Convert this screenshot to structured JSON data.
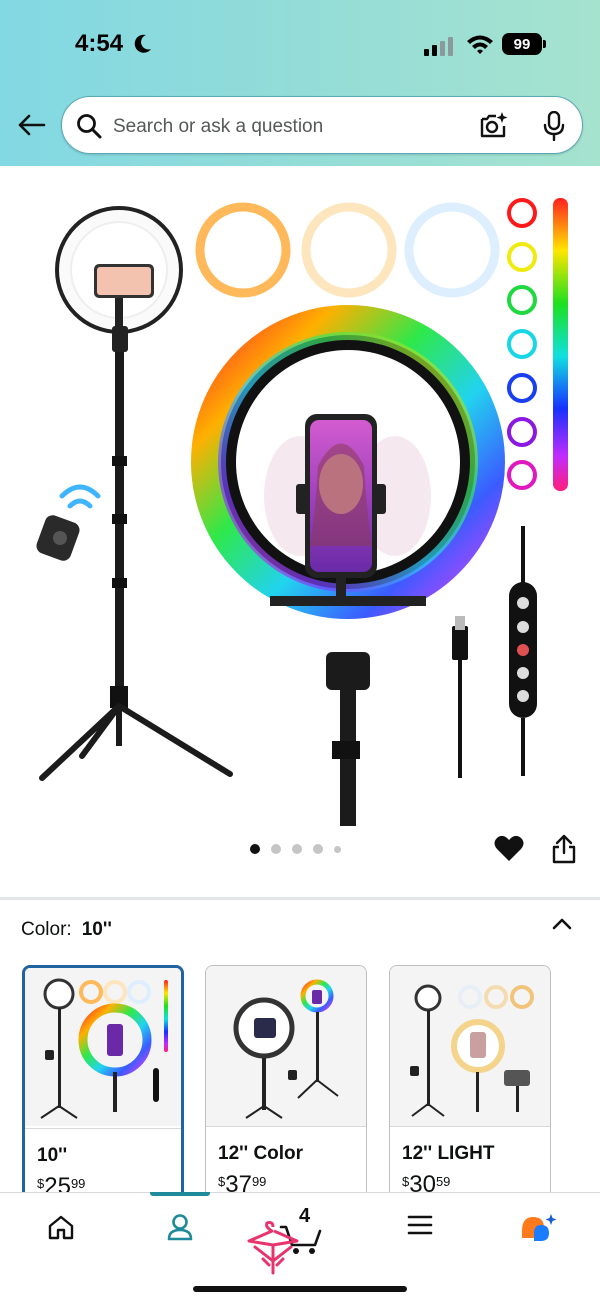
{
  "status_bar": {
    "time": "4:54",
    "battery": "99"
  },
  "search": {
    "placeholder": "Search or ask a question"
  },
  "gallery": {
    "image_count": 5,
    "active_index": 0
  },
  "color_selector": {
    "label": "Color:",
    "selected": "10''"
  },
  "variants": [
    {
      "name": "10''",
      "currency": "$",
      "whole": "25",
      "fraction": "99",
      "selected": true
    },
    {
      "name": "12'' Color",
      "currency": "$",
      "whole": "37",
      "fraction": "99",
      "selected": false
    },
    {
      "name": "12'' LIGHT",
      "currency": "$",
      "whole": "30",
      "fraction": "59",
      "selected": false
    }
  ],
  "bottom_nav": {
    "active": "account",
    "items": [
      "home",
      "account",
      "cart",
      "menu",
      "rufus"
    ],
    "cart_count": "4"
  },
  "colors": {
    "header_start": "#82d8e3",
    "header_end": "#a6e3cf",
    "accent": "#2162a1",
    "nav_active": "#1f8a99"
  }
}
